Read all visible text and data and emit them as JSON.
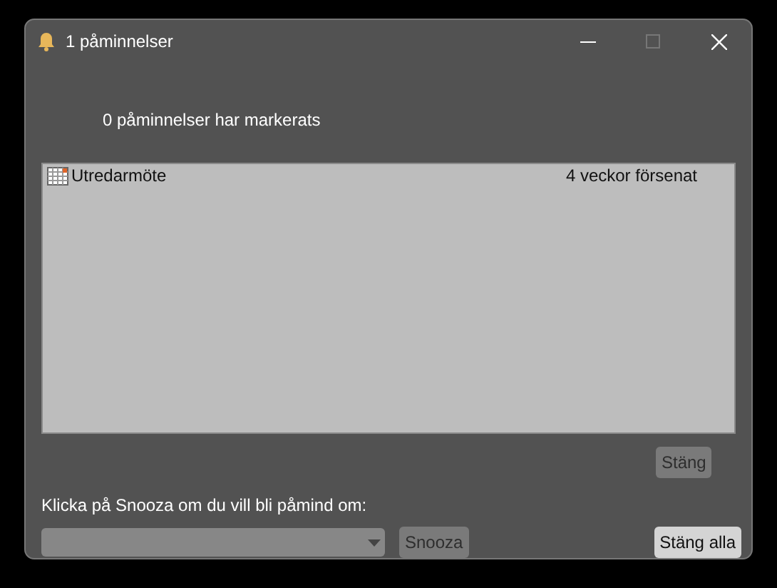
{
  "window": {
    "title": "1 påminnelser"
  },
  "summary": "0 påminnelser har markerats",
  "reminders": [
    {
      "subject": "Utredarmöte",
      "due": "4 veckor försenat",
      "selected": false
    }
  ],
  "dismiss_button": {
    "label": "Stäng",
    "disabled": true
  },
  "snooze_prompt": "Klicka på Snooza om du vill bli påmind om:",
  "snooze_select": {
    "disabled": true
  },
  "snooze_button": {
    "label": "Snooza",
    "disabled": true
  },
  "dismiss_all_button": {
    "label": "Stäng alla",
    "disabled": false
  }
}
